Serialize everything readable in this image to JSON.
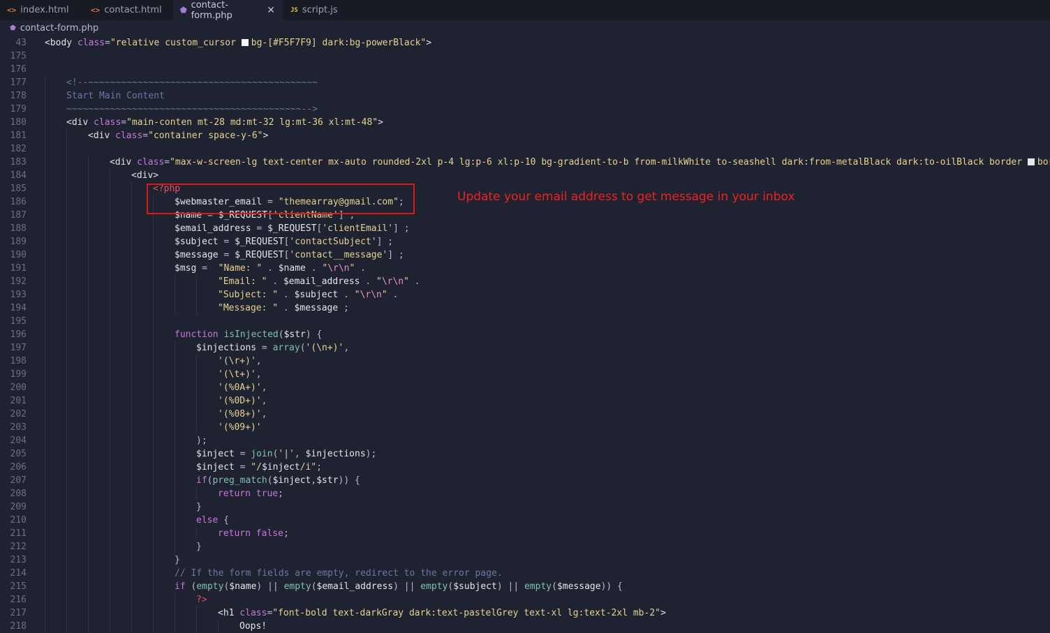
{
  "tabs": [
    {
      "label": "index.html",
      "icon": "<>",
      "kind": "html",
      "active": false
    },
    {
      "label": "contact.html",
      "icon": "<>",
      "kind": "html",
      "active": false
    },
    {
      "label": "contact-form.php",
      "icon": "php",
      "kind": "php",
      "active": true,
      "close": "✕"
    },
    {
      "label": "script.js",
      "icon": "JS",
      "kind": "js",
      "active": false
    }
  ],
  "breadcrumb": {
    "file": "contact-form.php"
  },
  "annotation": {
    "text": "Update your email address to get message in your inbox",
    "color": "#e11818"
  },
  "colors": {
    "background": "#1f2230",
    "tabbar": "#181a24",
    "string": "#e5d490",
    "keyword": "#c678dd",
    "comment": "#6a78a4"
  },
  "lines": [
    {
      "n": "43",
      "indent": 0,
      "tokens": [
        [
          "t-tag",
          "<body "
        ],
        [
          "t-attr",
          "class"
        ],
        [
          "t-punc",
          "="
        ],
        [
          "t-str",
          "\"relative custom_cursor "
        ],
        [
          "sw",
          "#F5F7F9"
        ],
        [
          "t-str",
          "bg-[#F5F7F9] dark:bg-powerBlack\""
        ],
        [
          "t-tag",
          ">"
        ]
      ]
    },
    {
      "n": "175",
      "indent": 0,
      "tokens": []
    },
    {
      "n": "176",
      "indent": 0,
      "tokens": []
    },
    {
      "n": "177",
      "indent": 1,
      "tokens": [
        [
          "t-cm",
          "<!--~~~~~~~~~~~~~~~~~~~~~~~~~~~~~~~~~~~~~~~~~~"
        ]
      ]
    },
    {
      "n": "178",
      "indent": 1,
      "tokens": [
        [
          "t-cm",
          "Start Main Content"
        ]
      ]
    },
    {
      "n": "179",
      "indent": 1,
      "tokens": [
        [
          "t-cm",
          "~~~~~~~~~~~~~~~~~~~~~~~~~~~~~~~~~~~~~~~~~~~-->"
        ]
      ]
    },
    {
      "n": "180",
      "indent": 1,
      "tokens": [
        [
          "t-tag",
          "<div "
        ],
        [
          "t-attr",
          "class"
        ],
        [
          "t-punc",
          "="
        ],
        [
          "t-str",
          "\"main-conten mt-28 md:mt-32 lg:mt-36 xl:mt-48\""
        ],
        [
          "t-tag",
          ">"
        ]
      ]
    },
    {
      "n": "181",
      "indent": 2,
      "tokens": [
        [
          "t-tag",
          "<div "
        ],
        [
          "t-attr",
          "class"
        ],
        [
          "t-punc",
          "="
        ],
        [
          "t-str",
          "\"container space-y-6\""
        ],
        [
          "t-tag",
          ">"
        ]
      ]
    },
    {
      "n": "182",
      "indent": 2,
      "tokens": []
    },
    {
      "n": "183",
      "indent": 3,
      "tokens": [
        [
          "t-tag",
          "<div "
        ],
        [
          "t-attr",
          "class"
        ],
        [
          "t-punc",
          "="
        ],
        [
          "t-str",
          "\"max-w-screen-lg text-center mx-auto rounded-2xl p-4 lg:p-6 xl:p-10 bg-gradient-to-b from-milkWhite to-seashell dark:from-metalBlack dark:to-oilBlack border "
        ],
        [
          "sw",
          "#e5e7eb"
        ],
        [
          "t-str",
          "borde"
        ]
      ]
    },
    {
      "n": "184",
      "indent": 4,
      "tokens": [
        [
          "t-tag",
          "<div>"
        ]
      ]
    },
    {
      "n": "185",
      "indent": 5,
      "tokens": [
        [
          "t-php",
          "<?php"
        ]
      ]
    },
    {
      "n": "186",
      "indent": 6,
      "tokens": [
        [
          "t-var",
          "$webmaster_email "
        ],
        [
          "t-punc",
          "= "
        ],
        [
          "t-str",
          "\"themearray@gmail.com\""
        ],
        [
          "t-punc",
          ";"
        ]
      ]
    },
    {
      "n": "187",
      "indent": 6,
      "tokens": [
        [
          "t-var",
          "$name "
        ],
        [
          "t-punc",
          "= "
        ],
        [
          "t-var",
          "$_REQUEST"
        ],
        [
          "t-punc",
          "["
        ],
        [
          "t-str",
          "'clientName'"
        ],
        [
          "t-punc",
          "] ;"
        ]
      ]
    },
    {
      "n": "188",
      "indent": 6,
      "tokens": [
        [
          "t-var",
          "$email_address "
        ],
        [
          "t-punc",
          "= "
        ],
        [
          "t-var",
          "$_REQUEST"
        ],
        [
          "t-punc",
          "["
        ],
        [
          "t-str",
          "'clientEmail'"
        ],
        [
          "t-punc",
          "] ;"
        ]
      ]
    },
    {
      "n": "189",
      "indent": 6,
      "tokens": [
        [
          "t-var",
          "$subject "
        ],
        [
          "t-punc",
          "= "
        ],
        [
          "t-var",
          "$_REQUEST"
        ],
        [
          "t-punc",
          "["
        ],
        [
          "t-str",
          "'contactSubject'"
        ],
        [
          "t-punc",
          "] ;"
        ]
      ]
    },
    {
      "n": "190",
      "indent": 6,
      "tokens": [
        [
          "t-var",
          "$message "
        ],
        [
          "t-punc",
          "= "
        ],
        [
          "t-var",
          "$_REQUEST"
        ],
        [
          "t-punc",
          "["
        ],
        [
          "t-str",
          "'contact__message'"
        ],
        [
          "t-punc",
          "] ;"
        ]
      ]
    },
    {
      "n": "191",
      "indent": 6,
      "tokens": [
        [
          "t-var",
          "$msg "
        ],
        [
          "t-punc",
          "=  "
        ],
        [
          "t-str",
          "\"Name: \""
        ],
        [
          "t-punc",
          " . "
        ],
        [
          "t-var",
          "$name"
        ],
        [
          "t-punc",
          " . "
        ],
        [
          "t-str",
          "\""
        ],
        [
          "t-esc",
          "\\r\\n"
        ],
        [
          "t-str",
          "\""
        ],
        [
          "t-punc",
          " ."
        ]
      ]
    },
    {
      "n": "192",
      "indent": 8,
      "tokens": [
        [
          "t-str",
          "\"Email: \""
        ],
        [
          "t-punc",
          " . "
        ],
        [
          "t-var",
          "$email_address"
        ],
        [
          "t-punc",
          " . "
        ],
        [
          "t-str",
          "\""
        ],
        [
          "t-esc",
          "\\r\\n"
        ],
        [
          "t-str",
          "\""
        ],
        [
          "t-punc",
          " ."
        ]
      ]
    },
    {
      "n": "193",
      "indent": 8,
      "tokens": [
        [
          "t-str",
          "\"Subject: \""
        ],
        [
          "t-punc",
          " . "
        ],
        [
          "t-var",
          "$subject"
        ],
        [
          "t-punc",
          " . "
        ],
        [
          "t-str",
          "\""
        ],
        [
          "t-esc",
          "\\r\\n"
        ],
        [
          "t-str",
          "\""
        ],
        [
          "t-punc",
          " ."
        ]
      ]
    },
    {
      "n": "194",
      "indent": 8,
      "tokens": [
        [
          "t-str",
          "\"Message: \""
        ],
        [
          "t-punc",
          " . "
        ],
        [
          "t-var",
          "$message"
        ],
        [
          "t-punc",
          " ;"
        ]
      ]
    },
    {
      "n": "195",
      "indent": 6,
      "tokens": []
    },
    {
      "n": "196",
      "indent": 6,
      "tokens": [
        [
          "t-kw",
          "function "
        ],
        [
          "t-fn",
          "isInjected"
        ],
        [
          "t-punc",
          "("
        ],
        [
          "t-var",
          "$str"
        ],
        [
          "t-punc",
          ") {"
        ]
      ]
    },
    {
      "n": "197",
      "indent": 7,
      "tokens": [
        [
          "t-var",
          "$injections "
        ],
        [
          "t-punc",
          "= "
        ],
        [
          "t-fn",
          "array"
        ],
        [
          "t-punc",
          "("
        ],
        [
          "t-str",
          "'(\\n+)'"
        ],
        [
          "t-punc",
          ","
        ]
      ]
    },
    {
      "n": "198",
      "indent": 8,
      "tokens": [
        [
          "t-str",
          "'(\\r+)'"
        ],
        [
          "t-punc",
          ","
        ]
      ]
    },
    {
      "n": "199",
      "indent": 8,
      "tokens": [
        [
          "t-str",
          "'(\\t+)'"
        ],
        [
          "t-punc",
          ","
        ]
      ]
    },
    {
      "n": "200",
      "indent": 8,
      "tokens": [
        [
          "t-str",
          "'(%0A+)'"
        ],
        [
          "t-punc",
          ","
        ]
      ]
    },
    {
      "n": "201",
      "indent": 8,
      "tokens": [
        [
          "t-str",
          "'(%0D+)'"
        ],
        [
          "t-punc",
          ","
        ]
      ]
    },
    {
      "n": "202",
      "indent": 8,
      "tokens": [
        [
          "t-str",
          "'(%08+)'"
        ],
        [
          "t-punc",
          ","
        ]
      ]
    },
    {
      "n": "203",
      "indent": 8,
      "tokens": [
        [
          "t-str",
          "'(%09+)'"
        ]
      ]
    },
    {
      "n": "204",
      "indent": 7,
      "tokens": [
        [
          "t-punc",
          ");"
        ]
      ]
    },
    {
      "n": "205",
      "indent": 7,
      "tokens": [
        [
          "t-var",
          "$inject "
        ],
        [
          "t-punc",
          "= "
        ],
        [
          "t-fn",
          "join"
        ],
        [
          "t-punc",
          "("
        ],
        [
          "t-str",
          "'|'"
        ],
        [
          "t-punc",
          ", "
        ],
        [
          "t-var",
          "$injections"
        ],
        [
          "t-punc",
          ");"
        ]
      ]
    },
    {
      "n": "206",
      "indent": 7,
      "tokens": [
        [
          "t-var",
          "$inject "
        ],
        [
          "t-punc",
          "= "
        ],
        [
          "t-str",
          "\"/"
        ],
        [
          "t-var",
          "$inject"
        ],
        [
          "t-str",
          "/i\""
        ],
        [
          "t-punc",
          ";"
        ]
      ]
    },
    {
      "n": "207",
      "indent": 7,
      "tokens": [
        [
          "t-kw",
          "if"
        ],
        [
          "t-punc",
          "("
        ],
        [
          "t-fn",
          "preg_match"
        ],
        [
          "t-punc",
          "("
        ],
        [
          "t-var",
          "$inject"
        ],
        [
          "t-punc",
          ","
        ],
        [
          "t-var",
          "$str"
        ],
        [
          "t-punc",
          ")) {"
        ]
      ]
    },
    {
      "n": "208",
      "indent": 8,
      "tokens": [
        [
          "t-kw",
          "return "
        ],
        [
          "t-attr",
          "true"
        ],
        [
          "t-punc",
          ";"
        ]
      ]
    },
    {
      "n": "209",
      "indent": 7,
      "tokens": [
        [
          "t-punc",
          "}"
        ]
      ]
    },
    {
      "n": "210",
      "indent": 7,
      "tokens": [
        [
          "t-kw",
          "else "
        ],
        [
          "t-punc",
          "{"
        ]
      ]
    },
    {
      "n": "211",
      "indent": 8,
      "tokens": [
        [
          "t-kw",
          "return "
        ],
        [
          "t-attr",
          "false"
        ],
        [
          "t-punc",
          ";"
        ]
      ]
    },
    {
      "n": "212",
      "indent": 7,
      "tokens": [
        [
          "t-punc",
          "}"
        ]
      ]
    },
    {
      "n": "213",
      "indent": 6,
      "tokens": [
        [
          "t-punc",
          "}"
        ]
      ]
    },
    {
      "n": "214",
      "indent": 6,
      "tokens": [
        [
          "t-cm",
          "// If the form fields are empty, redirect to the error page."
        ]
      ]
    },
    {
      "n": "215",
      "indent": 6,
      "tokens": [
        [
          "t-kw",
          "if "
        ],
        [
          "t-punc",
          "("
        ],
        [
          "t-fn",
          "empty"
        ],
        [
          "t-punc",
          "("
        ],
        [
          "t-var",
          "$name"
        ],
        [
          "t-punc",
          ") || "
        ],
        [
          "t-fn",
          "empty"
        ],
        [
          "t-punc",
          "("
        ],
        [
          "t-var",
          "$email_address"
        ],
        [
          "t-punc",
          ") || "
        ],
        [
          "t-fn",
          "empty"
        ],
        [
          "t-punc",
          "("
        ],
        [
          "t-var",
          "$subject"
        ],
        [
          "t-punc",
          ") || "
        ],
        [
          "t-fn",
          "empty"
        ],
        [
          "t-punc",
          "("
        ],
        [
          "t-var",
          "$message"
        ],
        [
          "t-punc",
          ")) {"
        ]
      ]
    },
    {
      "n": "216",
      "indent": 7,
      "tokens": [
        [
          "t-php",
          "?>"
        ]
      ]
    },
    {
      "n": "217",
      "indent": 8,
      "tokens": [
        [
          "t-tag",
          "<h1 "
        ],
        [
          "t-attr",
          "class"
        ],
        [
          "t-punc",
          "="
        ],
        [
          "t-str",
          "\"font-bold text-darkGray dark:text-pastelGrey text-xl lg:text-2xl mb-2\""
        ],
        [
          "t-tag",
          ">"
        ]
      ]
    },
    {
      "n": "218",
      "indent": 9,
      "tokens": [
        [
          "t-var",
          "Oops!"
        ]
      ]
    }
  ]
}
